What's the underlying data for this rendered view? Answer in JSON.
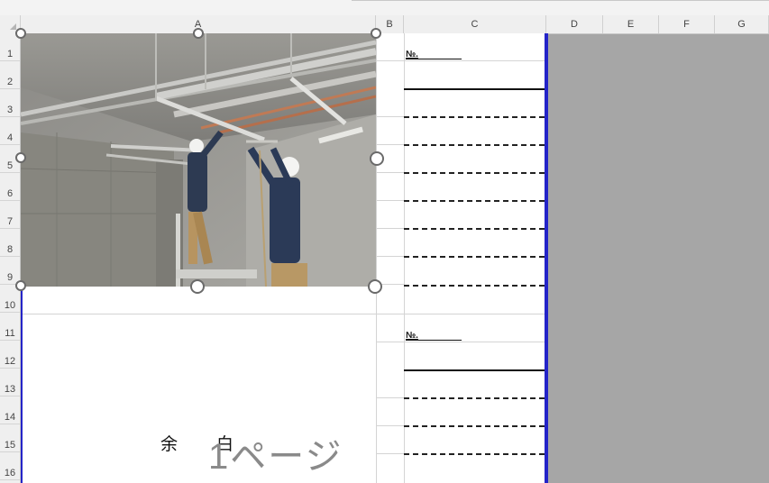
{
  "columns": [
    "A",
    "B",
    "C",
    "D",
    "E",
    "F",
    "G"
  ],
  "rows": [
    "1",
    "2",
    "3",
    "4",
    "5",
    "6",
    "7",
    "8",
    "9",
    "10",
    "11",
    "12",
    "13",
    "14",
    "15",
    "16"
  ],
  "form": {
    "no_label_1": "№.",
    "no_label_2": "№."
  },
  "margin_text": {
    "yo": "余",
    "haku": "白"
  },
  "page_label": "1ページ",
  "colors": {
    "page_border": "#2424c8",
    "outside_print_area": "#a6a6a6"
  },
  "image": {
    "description_icon": "photo-construction-workers"
  }
}
